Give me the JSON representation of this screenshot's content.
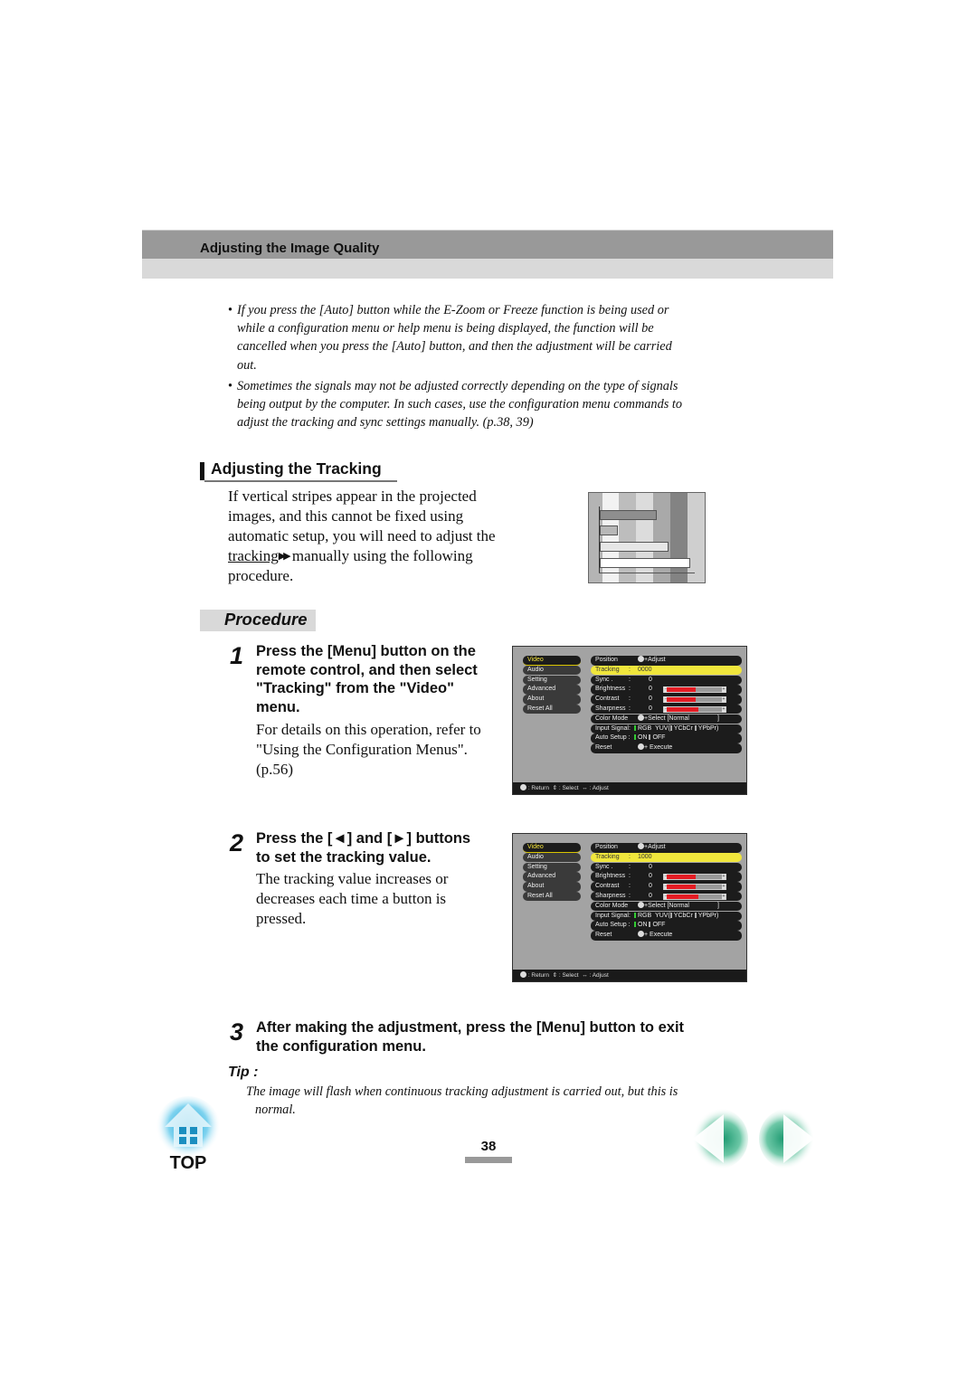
{
  "header": {
    "title": "Adjusting the Image Quality"
  },
  "notes": [
    {
      "bullet": "•",
      "lines": [
        "If you press the [Auto] button while the E-Zoom or Freeze function is being used or",
        "while a configuration menu or help menu is being displayed, the function will be",
        "cancelled when you press the [Auto] button, and then the adjustment will be carried",
        "out."
      ]
    },
    {
      "bullet": "•",
      "lines": [
        "Sometimes the signals may not be adjusted correctly depending on the type of signals",
        "being output by the computer. In such cases, use the configuration menu commands to",
        "adjust the tracking and sync settings manually. (p.38, 39)"
      ]
    }
  ],
  "section": {
    "title": "Adjusting the Tracking",
    "intro": {
      "line1": "If vertical stripes appear in the projected",
      "line2": "images, and this cannot be fixed using",
      "line3": "automatic setup, you will need to adjust the",
      "link": "tracking",
      "link_icon": "▶▶",
      "line4_rest": " manually using the following",
      "line5": "procedure."
    }
  },
  "procedure": {
    "title": "Procedure"
  },
  "steps": [
    {
      "number": "1",
      "head_lines": [
        "Press the [Menu] button on the",
        "remote control, and then select",
        "\"Tracking\" from the \"Video\"",
        "menu."
      ],
      "body_lines": [
        "For details on this operation, refer to",
        "\"Using the Configuration Menus\".",
        "(p.56)"
      ]
    },
    {
      "number": "2",
      "head_lines": [
        "Press the [◄] and [►] buttons",
        "to set the tracking value."
      ],
      "body_lines": [
        "The tracking value increases or",
        "decreases each time a button is",
        "pressed."
      ]
    },
    {
      "number": "3",
      "head_lines": [
        "After making the adjustment, press the [Menu] button to exit",
        "the configuration menu."
      ]
    }
  ],
  "osd_menus": [
    {
      "left_items": [
        "Video",
        "Audio",
        "Setting",
        "Advanced",
        "About",
        "Reset All"
      ],
      "selected_left": "Video",
      "rows": {
        "position": {
          "label": "Position",
          "action": "+Adjust"
        },
        "tracking": {
          "label": "Tracking",
          "sep": ":",
          "value": "0000"
        },
        "sync": {
          "label": "Sync .",
          "sep": ":",
          "value": "0"
        },
        "brightness": {
          "label": "Brightness",
          "sep": ":",
          "value": "0",
          "level": 0.5
        },
        "contrast": {
          "label": "Contrast",
          "sep": ":",
          "value": "0",
          "level": 0.5
        },
        "sharpness": {
          "label": "Sharpness",
          "sep": ":",
          "value": "0",
          "level": 0.55
        },
        "color_mode": {
          "label": "Color Mode",
          "action": "+Select [Normal",
          "close": "]"
        },
        "input_signal": {
          "label": "Input Signal:",
          "opt1": "RGB",
          "opt2": "YUV(",
          "opt3": "YCbCr",
          "opt4": "YPbPr)"
        },
        "auto_setup": {
          "label": "Auto Setup :",
          "opt1": "ON",
          "opt2": "OFF"
        },
        "reset": {
          "label": "Reset",
          "action": "+ Execute"
        }
      },
      "footer": {
        "return": ": Return",
        "select": ": Select",
        "adjust": ": Adjust"
      }
    },
    {
      "left_items": [
        "Video",
        "Audio",
        "Setting",
        "Advanced",
        "About",
        "Reset All"
      ],
      "selected_left": "Video",
      "rows": {
        "position": {
          "label": "Position",
          "action": "+Adjust"
        },
        "tracking": {
          "label": "Tracking",
          "sep": ":",
          "value": "1000"
        },
        "sync": {
          "label": "Sync .",
          "sep": ":",
          "value": "0"
        },
        "brightness": {
          "label": "Brightness",
          "sep": ":",
          "value": "0",
          "level": 0.5
        },
        "contrast": {
          "label": "Contrast",
          "sep": ":",
          "value": "0",
          "level": 0.5
        },
        "sharpness": {
          "label": "Sharpness",
          "sep": ":",
          "value": "0",
          "level": 0.55
        },
        "color_mode": {
          "label": "Color Mode",
          "action": "+Select [Normal",
          "close": "]"
        },
        "input_signal": {
          "label": "Input Signal:",
          "opt1": "RGB",
          "opt2": "YUV(",
          "opt3": "YCbCr",
          "opt4": "YPbPr)"
        },
        "auto_setup": {
          "label": "Auto Setup :",
          "opt1": "ON",
          "opt2": "OFF"
        },
        "reset": {
          "label": "Reset",
          "action": "+ Execute"
        }
      },
      "footer": {
        "return": ": Return",
        "select": ": Select",
        "adjust": ": Adjust"
      }
    }
  ],
  "tip": {
    "label": "Tip :",
    "line1": "The image will flash when continuous tracking adjustment is carried out, but this is",
    "line2": "normal."
  },
  "footer": {
    "page_number": "38",
    "top_label": "TOP",
    "prev_icon": "previous-page-icon",
    "next_icon": "next-page-icon"
  },
  "colors": {
    "header_dark": "#999999",
    "header_light": "#d9d9d9",
    "osd_highlight": "#f0e63c",
    "slider_fill": "#e41c24",
    "nav_green": "#2a9a78",
    "top_blue": "#4fc3e8"
  }
}
